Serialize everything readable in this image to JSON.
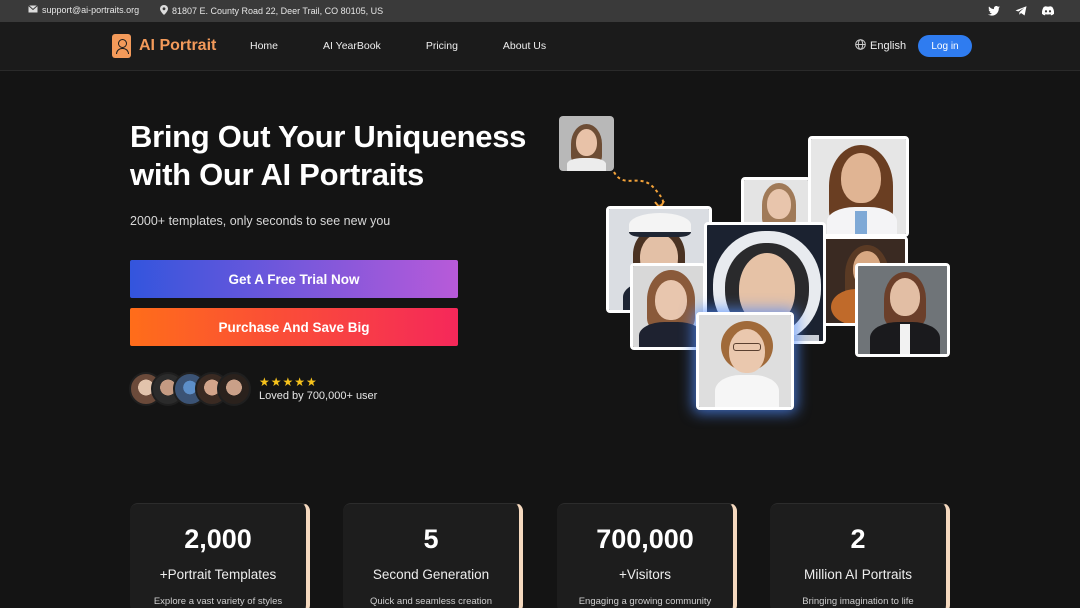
{
  "topbar": {
    "email": "support@ai-portraits.org",
    "address": "81807 E. County Road 22, Deer Trail, CO 80105, US",
    "socials": [
      "twitter-icon",
      "telegram-icon",
      "discord-icon"
    ]
  },
  "nav": {
    "brand": "AI Portrait",
    "menu": [
      "Home",
      "AI YearBook",
      "Pricing",
      "About Us"
    ],
    "language": "English",
    "login": "Log in"
  },
  "hero": {
    "title": "Bring Out Your Uniqueness with Our AI Portraits",
    "subtitle": "2000+ templates, only seconds to see new you",
    "trial_button": "Get A Free Trial Now",
    "buy_button": "Purchase And Save Big",
    "rating_stars": "★★★★★",
    "loved_text": "Loved by 700,000+ user"
  },
  "stats": [
    {
      "number": "2,000",
      "label": "+Portrait Templates",
      "desc": "Explore a vast variety of styles"
    },
    {
      "number": "5",
      "label": "Second Generation",
      "desc": "Quick and seamless creation"
    },
    {
      "number": "700,000",
      "label": "+Visitors",
      "desc": "Engaging a growing community"
    },
    {
      "number": "2",
      "label": "Million AI Portraits",
      "desc": "Bringing imagination to life"
    }
  ],
  "colors": {
    "accent": "#f39a5a",
    "login_blue": "#2f7cf0",
    "star": "#f6c21c"
  }
}
